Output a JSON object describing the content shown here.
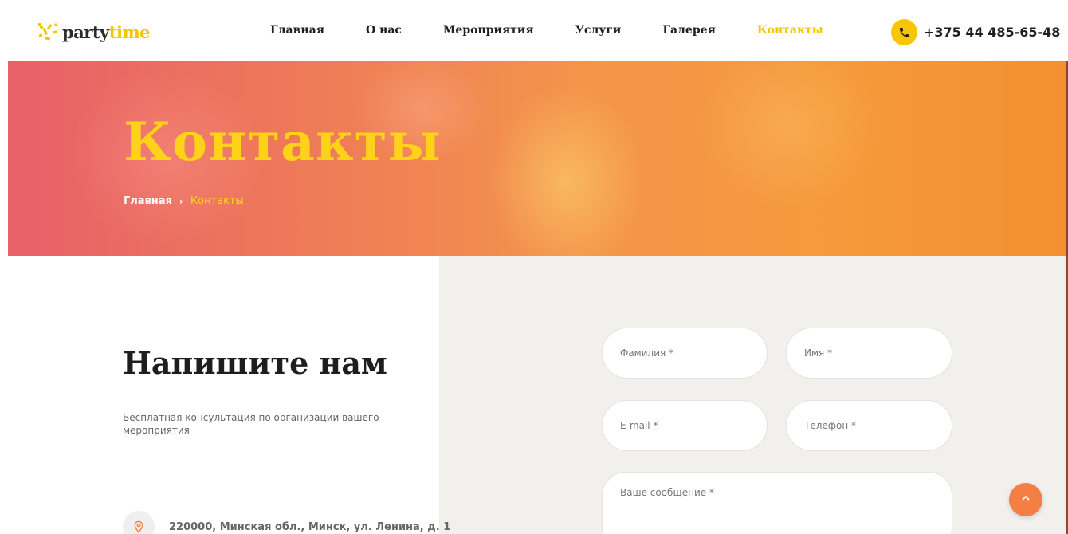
{
  "brand": {
    "logo_part1": "party",
    "logo_part2": "time",
    "accent_color": "#f5c500"
  },
  "nav": {
    "items": [
      {
        "label": "Главная",
        "active": false
      },
      {
        "label": "О нас",
        "active": false
      },
      {
        "label": "Мероприятия",
        "active": false
      },
      {
        "label": "Услуги",
        "active": false
      },
      {
        "label": "Галерея",
        "active": false
      },
      {
        "label": "Контакты",
        "active": true
      }
    ]
  },
  "header": {
    "phone": "+375 44 485-65-48",
    "phone_icon": "phone-icon"
  },
  "hero": {
    "title": "Контакты",
    "breadcrumb": {
      "home": "Главная",
      "separator": "›",
      "current": "Контакты"
    }
  },
  "contact": {
    "title": "Напишите нам",
    "subtitle": "Бесплатная консультация по организации вашего мероприятия",
    "address": "220000, Минская обл., Минск, ул. Ленина, д. 1",
    "address_icon": "location-pin-icon"
  },
  "form": {
    "last_name_placeholder": "Фамилия *",
    "first_name_placeholder": "Имя *",
    "email_placeholder": "E-mail *",
    "phone_placeholder": "Телефон *",
    "message_placeholder": "Ваше сообщение *"
  },
  "scroll_top": {
    "icon": "chevron-up-icon",
    "color": "#f47f44"
  }
}
